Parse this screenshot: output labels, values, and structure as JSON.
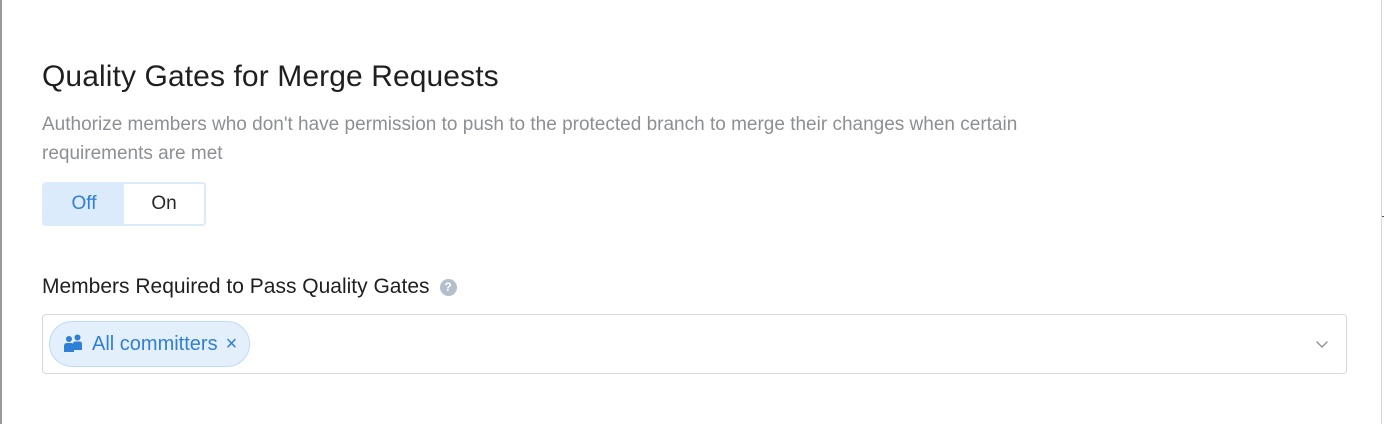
{
  "section": {
    "title": "Quality Gates for Merge Requests",
    "description": "Authorize members who don't have permission to push to the protected branch to merge their changes when certain requirements are met"
  },
  "toggle": {
    "off_label": "Off",
    "on_label": "On",
    "selected": "Off"
  },
  "members_field": {
    "label": "Members Required to Pass Quality Gates",
    "help_icon": "question-circle-icon",
    "help_glyph": "?",
    "selected_chips": [
      {
        "label": "All committers",
        "icon": "users-icon",
        "remove_glyph": "×"
      }
    ],
    "dropdown_icon": "chevron-down-icon"
  },
  "colors": {
    "accent": "#2f7fd6",
    "toggle_active_bg": "#dcebfb",
    "chip_bg": "#e4effc",
    "muted_text": "#8c8f94"
  }
}
